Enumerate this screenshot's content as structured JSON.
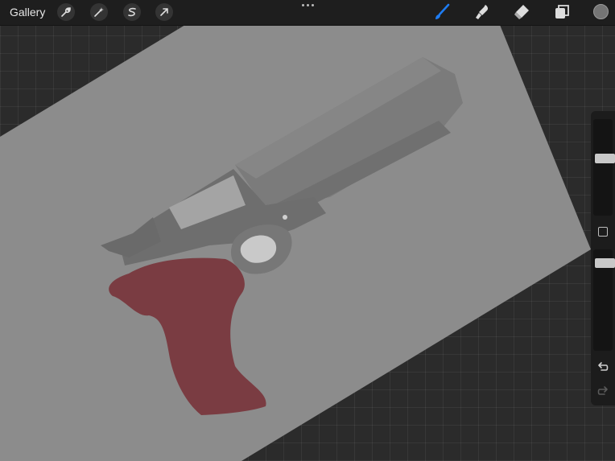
{
  "toolbar": {
    "gallery_label": "Gallery",
    "left_tools": [
      "wrench-icon",
      "magic-wand-icon",
      "selection-s-icon",
      "transform-arrow-icon"
    ],
    "right_tools": [
      "brush-icon",
      "smudge-icon",
      "eraser-icon",
      "layers-icon"
    ],
    "active_tool": "brush-icon",
    "active_color": "#1e7cf2",
    "current_color": "#757575"
  },
  "sidebar": {
    "brush_size_level": 0.6,
    "opacity_level": 0.9,
    "undo_icon": "undo-icon",
    "redo_icon": "redo-icon"
  },
  "canvas": {
    "background_color": "#2b2b2b",
    "artboard_color": "#8b8b8b",
    "grip_color": "#7a3c42"
  }
}
